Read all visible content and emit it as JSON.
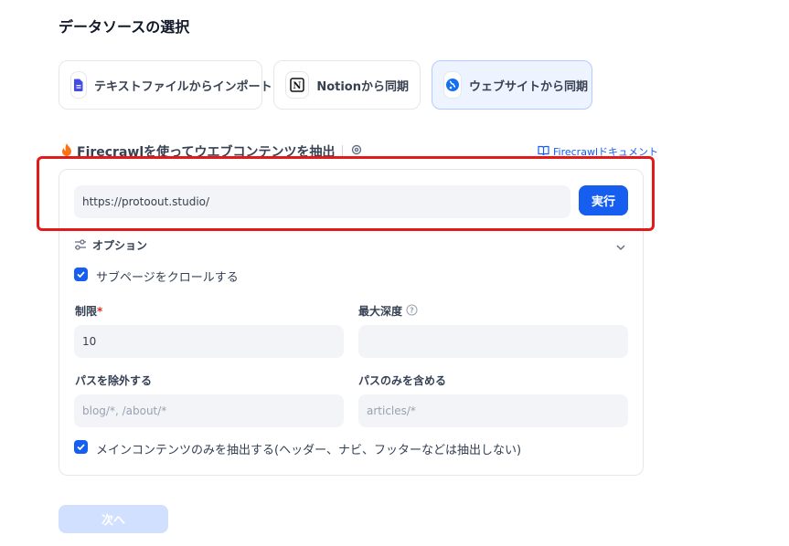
{
  "page_title": "データソースの選択",
  "sources": [
    {
      "label": "テキストファイルからインポート",
      "icon": "file-text-icon"
    },
    {
      "label": "Notionから同期",
      "icon": "notion-icon"
    },
    {
      "label": "ウェブサイトから同期",
      "icon": "globe-icon",
      "active": true
    }
  ],
  "firecrawl": {
    "heading": "Firecrawlを使ってウエブコンテンツを抽出",
    "doc_link": "Firecrawlドキュメント"
  },
  "url_input": {
    "value": "https://protoout.studio/"
  },
  "run_button": "実行",
  "options": {
    "label": "オプション",
    "crawl_subpages": "サブページをクロールする",
    "limit_label": "制限",
    "required_mark": "*",
    "limit_value": "10",
    "max_depth_label": "最大深度",
    "exclude_label": "パスを除外する",
    "exclude_placeholder": "blog/*, /about/*",
    "include_label": "パスのみを含める",
    "include_placeholder": "articles/*",
    "main_content_only": "メインコンテンツのみを抽出する(ヘッダー、ナビ、フッターなどは抽出しない)"
  },
  "next_button": "次へ",
  "colors": {
    "accent": "#155eef",
    "highlight": "#e31a1a"
  }
}
